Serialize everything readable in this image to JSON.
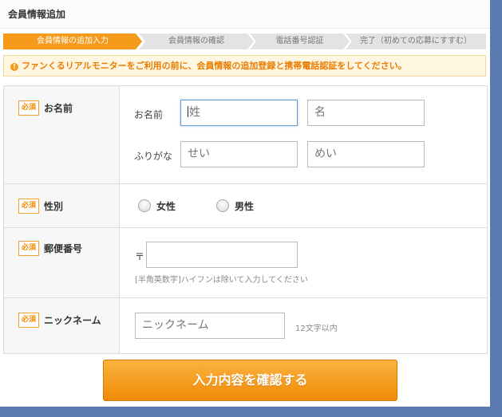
{
  "page_title": "会員情報追加",
  "steps": [
    {
      "label": "会員情報の追加入力",
      "active": true
    },
    {
      "label": "会員情報の確認",
      "active": false
    },
    {
      "label": "電話番号認証",
      "active": false
    },
    {
      "label": "完了（初めての応募にすすむ）",
      "active": false
    }
  ],
  "notice": {
    "icon": "!",
    "text": "ファンくるリアルモニターをご利用の前に、会員情報の追加登録と携帯電話認証をしてください。"
  },
  "required_badge": "必須",
  "name_row": {
    "label": "お名前",
    "name_sub_label": "お名前",
    "last_name_placeholder": "姓",
    "first_name_placeholder": "名",
    "kana_sub_label": "ふりがな",
    "last_kana_placeholder": "せい",
    "first_kana_placeholder": "めい"
  },
  "gender_row": {
    "label": "性別",
    "option_female": "女性",
    "option_male": "男性"
  },
  "postal_row": {
    "label": "郵便番号",
    "postal_mark": "〒",
    "hint": "[半角英数字]ハイフンは除いて入力してください"
  },
  "nickname_row": {
    "label": "ニックネーム",
    "placeholder": "ニックネーム",
    "hint": "12文字以内"
  },
  "submit_label": "入力内容を確認する",
  "colors": {
    "accent": "#f59a1b",
    "notice_bg": "#fff6e2",
    "notice_text": "#ea7d00",
    "background": "#5b7bb0"
  }
}
